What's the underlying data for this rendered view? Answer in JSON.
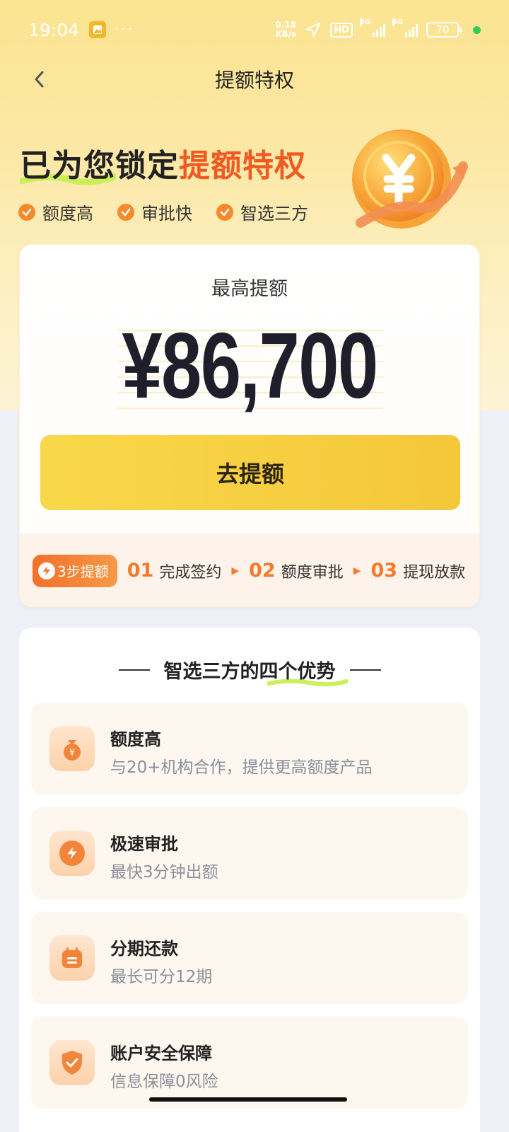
{
  "status_bar": {
    "time": "19:04",
    "dots": "···",
    "speed_value": "0.18",
    "speed_unit": "KB/s",
    "hd_label": "HD",
    "network1": "5G",
    "network2": "5G",
    "battery": "70"
  },
  "nav": {
    "title": "提额特权"
  },
  "hero": {
    "title_prefix": "已为您锁定",
    "title_highlight": "提额特权",
    "tags": [
      "额度高",
      "审批快",
      "智选三方"
    ]
  },
  "amount_card": {
    "label": "最高提额",
    "amount": "¥86,700",
    "button_label": "去提额"
  },
  "steps": {
    "badge": "3步提额",
    "items": [
      {
        "num": "01",
        "label": "完成签约"
      },
      {
        "num": "02",
        "label": "额度审批"
      },
      {
        "num": "03",
        "label": "提现放款"
      }
    ]
  },
  "advantages": {
    "title": "智选三方的四个优势",
    "items": [
      {
        "name": "额度高",
        "desc": "与20+机构合作，提供更高额度产品",
        "icon": "money-bag-icon"
      },
      {
        "name": "极速审批",
        "desc": "最快3分钟出额",
        "icon": "lightning-icon"
      },
      {
        "name": "分期还款",
        "desc": "最长可分12期",
        "icon": "calendar-icon"
      },
      {
        "name": "账户安全保障",
        "desc": "信息保障0风险",
        "icon": "shield-icon"
      }
    ]
  },
  "colors": {
    "accent": "#f05a22",
    "button": "#f7d447",
    "step_orange": "#f37a2c"
  }
}
